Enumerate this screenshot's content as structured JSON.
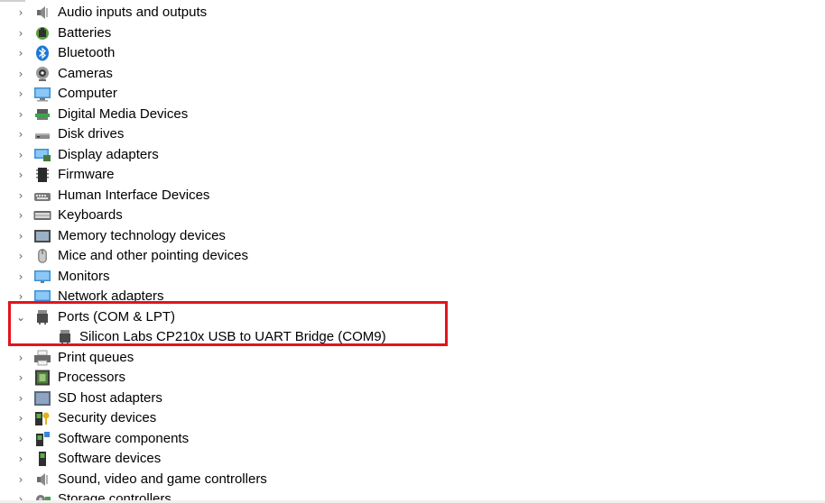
{
  "tree": {
    "items": [
      {
        "label": "Audio inputs and outputs",
        "expanded": false,
        "icon": "speaker-icon"
      },
      {
        "label": "Batteries",
        "expanded": false,
        "icon": "battery-icon"
      },
      {
        "label": "Bluetooth",
        "expanded": false,
        "icon": "bluetooth-icon"
      },
      {
        "label": "Cameras",
        "expanded": false,
        "icon": "camera-icon"
      },
      {
        "label": "Computer",
        "expanded": false,
        "icon": "computer-icon"
      },
      {
        "label": "Digital Media Devices",
        "expanded": false,
        "icon": "media-device-icon"
      },
      {
        "label": "Disk drives",
        "expanded": false,
        "icon": "disk-drive-icon"
      },
      {
        "label": "Display adapters",
        "expanded": false,
        "icon": "display-adapter-icon"
      },
      {
        "label": "Firmware",
        "expanded": false,
        "icon": "firmware-chip-icon"
      },
      {
        "label": "Human Interface Devices",
        "expanded": false,
        "icon": "hid-icon"
      },
      {
        "label": "Keyboards",
        "expanded": false,
        "icon": "keyboard-icon"
      },
      {
        "label": "Memory technology devices",
        "expanded": false,
        "icon": "memory-card-icon"
      },
      {
        "label": "Mice and other pointing devices",
        "expanded": false,
        "icon": "mouse-icon"
      },
      {
        "label": "Monitors",
        "expanded": false,
        "icon": "monitor-icon"
      },
      {
        "label": "Network adapters",
        "expanded": false,
        "icon": "network-adapter-icon"
      },
      {
        "label": "Ports (COM & LPT)",
        "expanded": true,
        "icon": "port-icon",
        "children": [
          {
            "label": "Silicon Labs CP210x USB to UART Bridge (COM9)",
            "icon": "port-icon"
          }
        ]
      },
      {
        "label": "Print queues",
        "expanded": false,
        "icon": "printer-icon"
      },
      {
        "label": "Processors",
        "expanded": false,
        "icon": "processor-icon"
      },
      {
        "label": "SD host adapters",
        "expanded": false,
        "icon": "sd-adapter-icon"
      },
      {
        "label": "Security devices",
        "expanded": false,
        "icon": "security-key-icon"
      },
      {
        "label": "Software components",
        "expanded": false,
        "icon": "software-component-icon"
      },
      {
        "label": "Software devices",
        "expanded": false,
        "icon": "software-device-icon"
      },
      {
        "label": "Sound, video and game controllers",
        "expanded": false,
        "icon": "sound-controller-icon"
      },
      {
        "label": "Storage controllers",
        "expanded": false,
        "icon": "storage-controller-icon"
      }
    ]
  },
  "colors": {
    "highlight": "#e3141b",
    "chevron": "#5f5f5f",
    "text": "#000000"
  }
}
